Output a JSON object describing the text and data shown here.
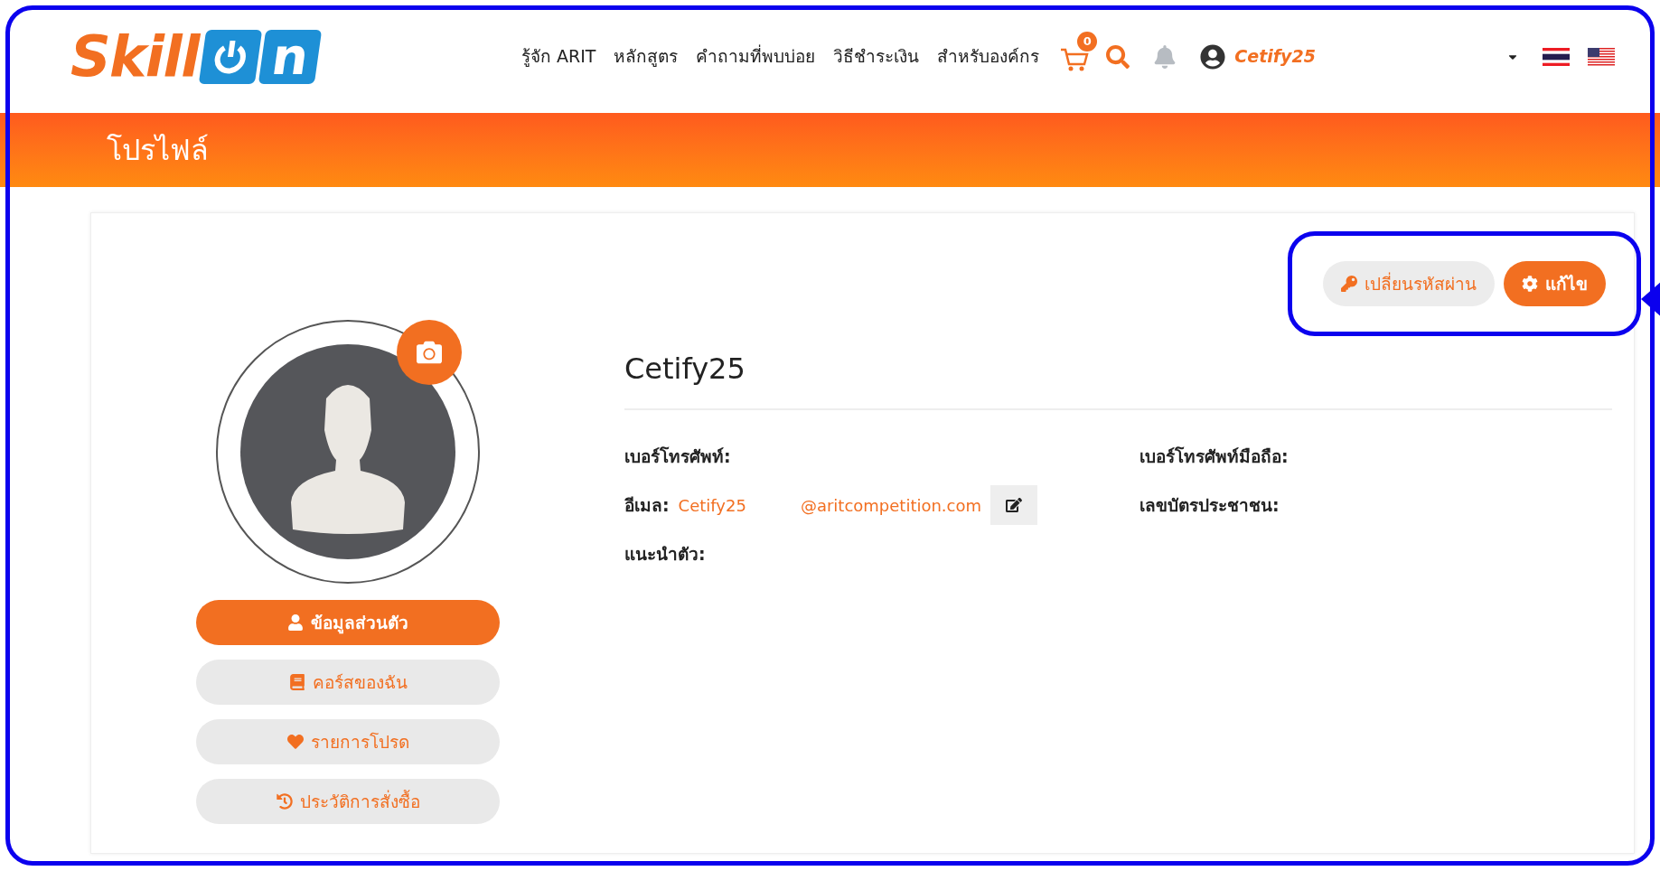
{
  "header": {
    "logo": {
      "word": "Skill",
      "power_letter": "n"
    },
    "nav": [
      "รู้จัก ARIT",
      "หลักสูตร",
      "คำถามที่พบบ่อย",
      "วิธีชำระเงิน",
      "สำหรับองค์กร"
    ],
    "cart_count": "0",
    "username": "Cetify25"
  },
  "banner": {
    "title": "โปรไฟล์"
  },
  "actions": [
    {
      "kind": "key",
      "label": "เปลี่ยนรหัสผ่าน",
      "primary": false
    },
    {
      "kind": "gear",
      "label": "แก้ไข",
      "primary": true
    }
  ],
  "highlight": {
    "on": true
  },
  "menu": [
    {
      "kind": "user",
      "label": "ข้อมูลส่วนตัว",
      "selected": true
    },
    {
      "kind": "book",
      "label": "คอร์สของฉัน",
      "selected": false
    },
    {
      "kind": "heart",
      "label": "รายการโปรด",
      "selected": false
    },
    {
      "kind": "history",
      "label": "ประวัติการสั่งซื้อ",
      "selected": false
    }
  ],
  "profile": {
    "name": "Cetify25",
    "fields_left": [
      {
        "label": "เบอร์โทรศัพท์:"
      },
      {
        "label": "อีเมล:",
        "value_parts": [
          "Cetify25",
          "@aritcompetition.com"
        ],
        "editable": true
      },
      {
        "label": "แนะนำตัว:"
      }
    ],
    "fields_right": [
      {
        "label": "เบอร์โทรศัพท์มือถือ:"
      },
      {
        "label": "เลขบัตรประชาชน:"
      }
    ]
  }
}
